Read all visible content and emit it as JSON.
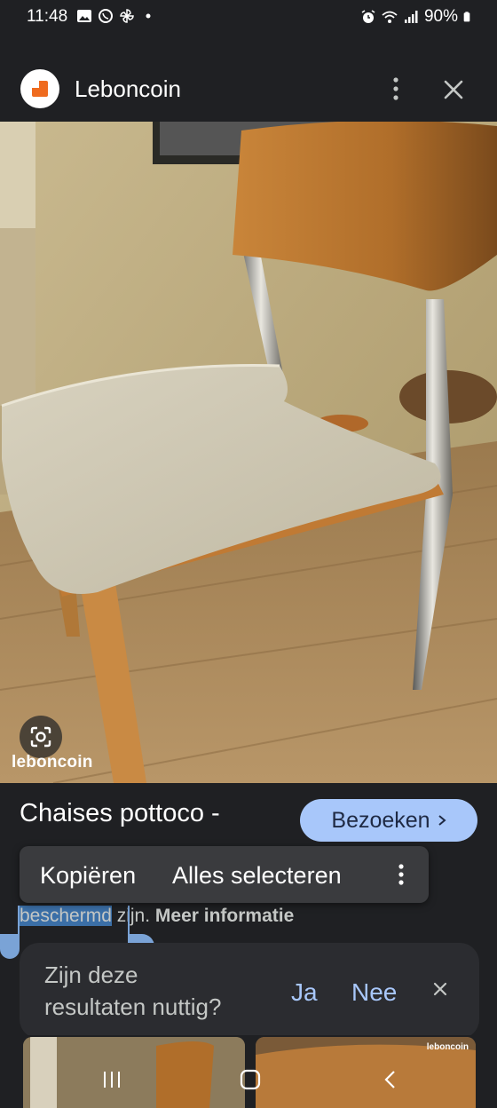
{
  "status_bar": {
    "time": "11:48",
    "battery": "90%",
    "left_icons": [
      "gallery-icon",
      "whatsapp-icon",
      "pinwheel-icon",
      "dot-icon"
    ],
    "right_icons": [
      "alarm-icon",
      "wifi-icon",
      "signal-icon",
      "battery-icon"
    ]
  },
  "header": {
    "site_name": "Leboncoin",
    "logo_color": "#ef6b1f"
  },
  "image": {
    "watermark": "leboncoin"
  },
  "result": {
    "title": "Chaises pottoco -",
    "visit_label": "Bezoeken",
    "snippet_selected": "beschermd",
    "snippet_rest": " zijn. ",
    "more_info": "Meer informatie"
  },
  "context_menu": {
    "copy": "Kopiëren",
    "select_all": "Alles selecteren"
  },
  "feedback": {
    "question_line1": "Zijn deze",
    "question_line2": "resultaten nuttig?",
    "yes": "Ja",
    "no": "Nee"
  },
  "thumbnails": {
    "watermark": "leboncoin"
  },
  "colors": {
    "background": "#1f2023",
    "accent": "#a8c7fa",
    "selection": "#3b6fa7"
  }
}
